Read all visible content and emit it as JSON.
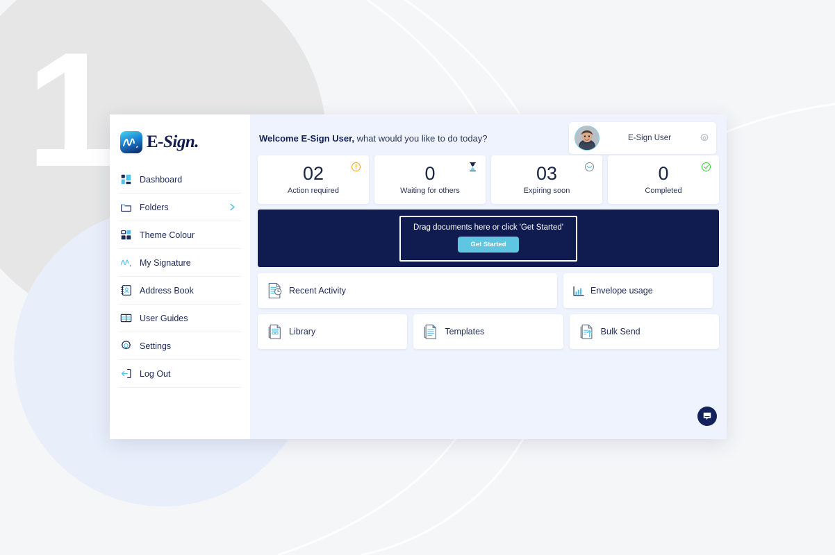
{
  "background": {
    "numeral": "1",
    "circle_gray": "#e6e6e6",
    "circle_blue": "#e8effb",
    "arc_color": "#ffffff",
    "page_bg": "#f5f6f8"
  },
  "brand": {
    "name_prefix": "E-",
    "name_suffix": "Sign",
    "mark_icon": "signature-mark-icon",
    "gradient_from": "#46d6f0",
    "gradient_to": "#111f5c"
  },
  "sidebar": {
    "items": [
      {
        "label": "Dashboard",
        "icon": "dashboard-icon",
        "chevron": false
      },
      {
        "label": "Folders",
        "icon": "folder-icon",
        "chevron": true
      },
      {
        "label": "Theme Colour",
        "icon": "theme-colour-icon",
        "chevron": false
      },
      {
        "label": "My Signature",
        "icon": "signature-icon",
        "chevron": false
      },
      {
        "label": "Address Book",
        "icon": "address-book-icon",
        "chevron": false
      },
      {
        "label": "User Guides",
        "icon": "book-icon",
        "chevron": false
      },
      {
        "label": "Settings",
        "icon": "gear-icon",
        "chevron": false
      },
      {
        "label": "Log Out",
        "icon": "logout-icon",
        "chevron": false
      }
    ],
    "chevron_color": "#5bc4e8"
  },
  "header": {
    "welcome_bold": "Welcome E-Sign User,",
    "welcome_rest": " what would you like to do today?",
    "user_name": "E-Sign User",
    "settings_icon": "gear-icon",
    "avatar_icon": "user-avatar-photo"
  },
  "stats": [
    {
      "value": "02",
      "label": "Action required",
      "icon": "alert-circle-icon",
      "color": "#f5a623"
    },
    {
      "value": "0",
      "label": "Waiting for others",
      "icon": "hourglass-icon",
      "color": "#1b2545"
    },
    {
      "value": "03",
      "label": "Expiring soon",
      "icon": "clock-icon",
      "color": "#6e7891"
    },
    {
      "value": "0",
      "label": "Completed",
      "icon": "check-circle-icon",
      "color": "#3ad13a"
    }
  ],
  "dropzone": {
    "text": "Drag documents here or click 'Get Started'",
    "button_label": "Get Started",
    "bg": "#101c50",
    "button_color": "#5ec6e0"
  },
  "tiles_row1": [
    {
      "label": "Recent Activity",
      "icon": "recent-activity-icon"
    },
    {
      "label": "Envelope usage",
      "icon": "bar-chart-icon"
    }
  ],
  "tiles_row2": [
    {
      "label": "Library",
      "icon": "library-doc-icon"
    },
    {
      "label": "Templates",
      "icon": "template-doc-icon"
    },
    {
      "label": "Bulk Send",
      "icon": "bulk-send-doc-icon"
    }
  ],
  "chat": {
    "icon": "chat-bubble-icon",
    "bg": "#12205c"
  }
}
